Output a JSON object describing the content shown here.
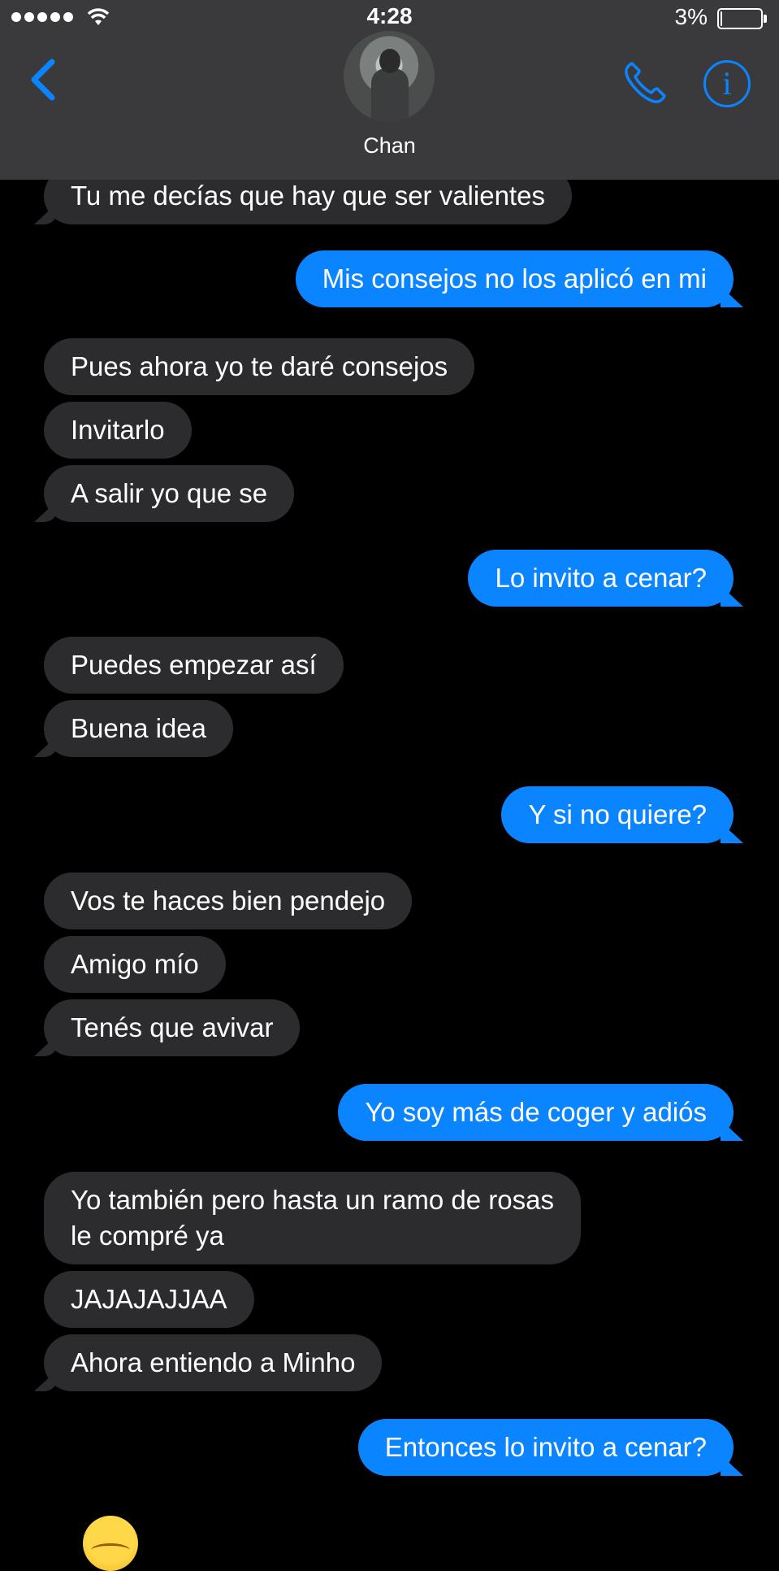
{
  "status_bar": {
    "time": "4:28",
    "battery_percent": "3%",
    "battery_level": 0.03
  },
  "header": {
    "contact_name": "Chan"
  },
  "colors": {
    "accent": "#0a84ff",
    "incoming_bubble": "#2c2c2e",
    "header_bg": "#3a3a3c"
  },
  "messages": [
    {
      "dir": "in",
      "text": "Tu me decías que hay que ser valientes"
    },
    {
      "dir": "out",
      "text": "Mis consejos no los aplicó en mi"
    },
    {
      "dir": "in",
      "text": "Pues ahora yo te daré consejos"
    },
    {
      "dir": "in",
      "text": "Invitarlo"
    },
    {
      "dir": "in",
      "text": "A salir yo que se"
    },
    {
      "dir": "out",
      "text": "Lo invito a cenar?"
    },
    {
      "dir": "in",
      "text": "Puedes empezar así"
    },
    {
      "dir": "in",
      "text": "Buena idea"
    },
    {
      "dir": "out",
      "text": "Y si no quiere?"
    },
    {
      "dir": "in",
      "text": "Vos te haces bien pendejo"
    },
    {
      "dir": "in",
      "text": "Amigo mío"
    },
    {
      "dir": "in",
      "text": "Tenés que avivar"
    },
    {
      "dir": "out",
      "text": "Yo soy más de coger y adiós"
    },
    {
      "dir": "in",
      "text": "Yo también pero hasta un ramo de rosas\nle compré ya"
    },
    {
      "dir": "in",
      "text": "JAJAJAJJAA"
    },
    {
      "dir": "in",
      "text": "Ahora entiendo a Minho"
    },
    {
      "dir": "out",
      "text": "Entonces lo invito a cenar?"
    }
  ],
  "icons": {
    "back": "chevron-left-icon",
    "call": "phone-icon",
    "info": "info-icon"
  }
}
